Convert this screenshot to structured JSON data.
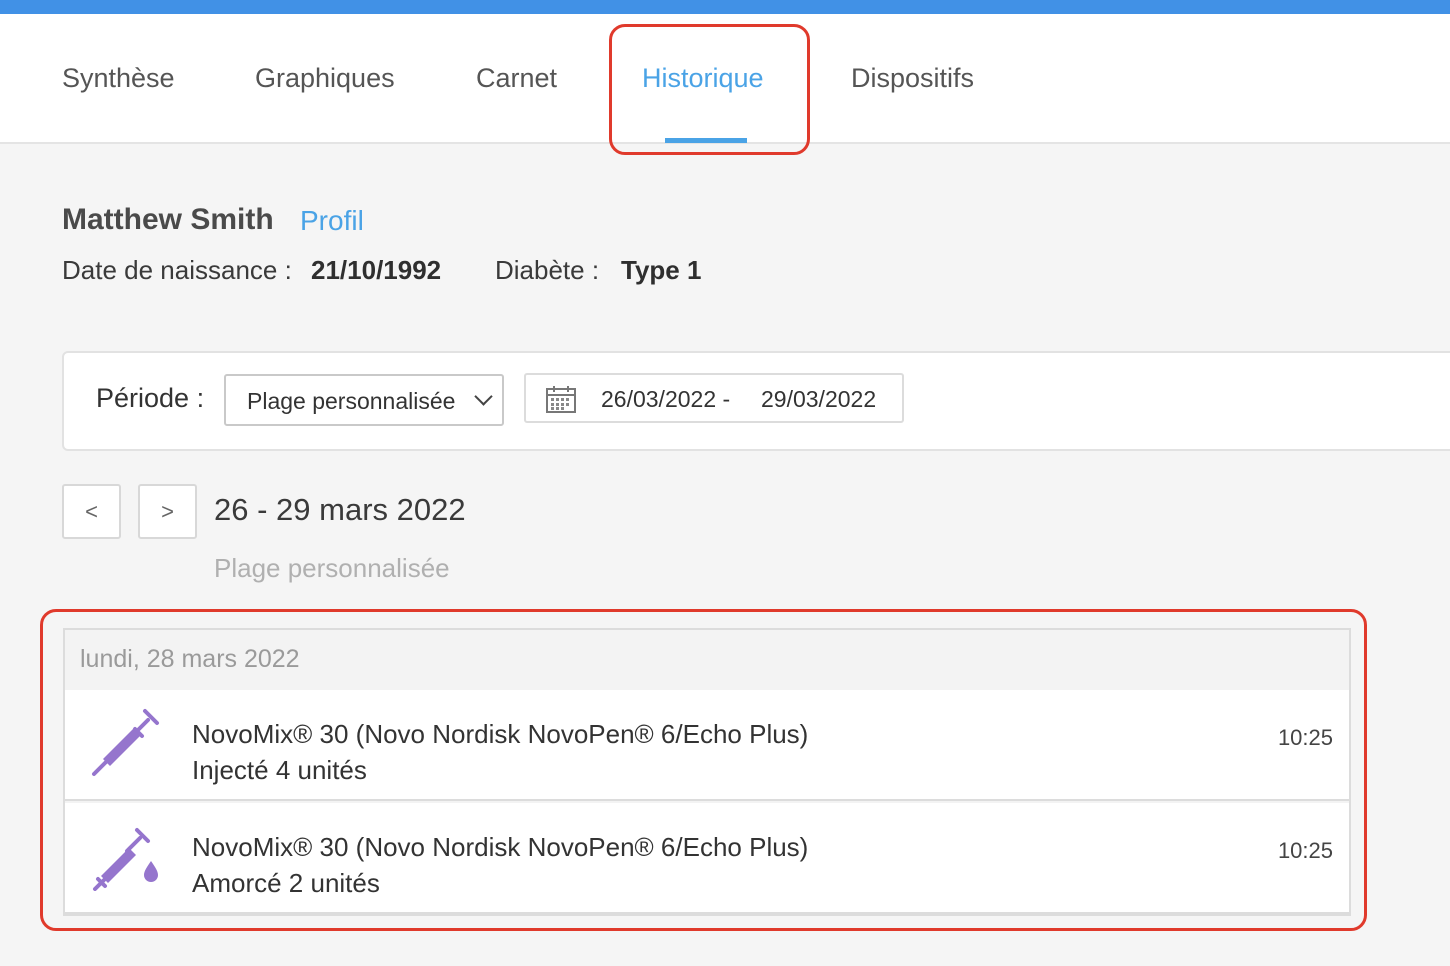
{
  "tabs": [
    {
      "label": "Synthèse",
      "active": false
    },
    {
      "label": "Graphiques",
      "active": false
    },
    {
      "label": "Carnet",
      "active": false
    },
    {
      "label": "Historique",
      "active": true
    },
    {
      "label": "Dispositifs",
      "active": false
    }
  ],
  "patient": {
    "name": "Matthew Smith",
    "profile_link": "Profil",
    "dob_label": "Date de naissance :",
    "dob_value": "21/10/1992",
    "diabetes_label": "Diabète :",
    "diabetes_value": "Type 1"
  },
  "period": {
    "label": "Période :",
    "selected_option": "Plage personnalisée",
    "date_from": "26/03/2022 -",
    "date_to": "29/03/2022"
  },
  "navigation": {
    "prev_label": "<",
    "next_label": ">",
    "range_title": "26 - 29 mars 2022",
    "range_subtitle": "Plage personnalisée"
  },
  "history": {
    "day_label": "lundi, 28 mars 2022",
    "events": [
      {
        "icon": "syringe-icon",
        "title": "NovoMix® 30 (Novo Nordisk NovoPen® 6/Echo Plus)",
        "detail": "Injecté 4 unités",
        "time": "10:25"
      },
      {
        "icon": "syringe-drop-icon",
        "title": "NovoMix® 30 (Novo Nordisk NovoPen® 6/Echo Plus)",
        "detail": "Amorcé 2 unités",
        "time": "10:25"
      }
    ]
  },
  "colors": {
    "accent": "#4aa3e6",
    "top_bar": "#4191e6",
    "highlight": "#e03a2c",
    "insulin_icon": "#9575cd"
  }
}
